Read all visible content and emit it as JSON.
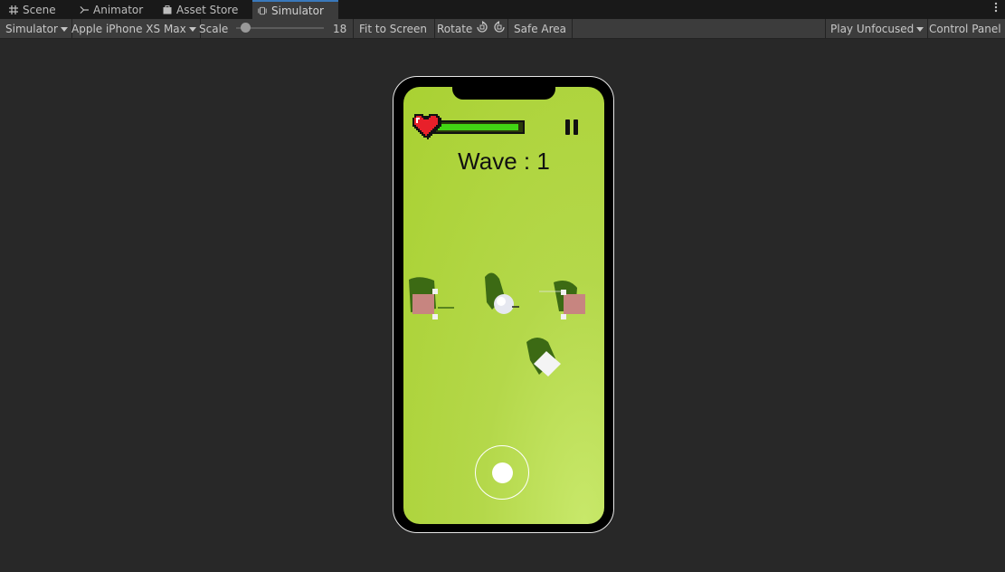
{
  "tabs": [
    {
      "label": "Scene",
      "icon": "grid-icon"
    },
    {
      "label": "Animator",
      "icon": "animator-icon"
    },
    {
      "label": "Asset Store",
      "icon": "bag-icon"
    },
    {
      "label": "Simulator",
      "icon": "simulator-icon",
      "active": true
    }
  ],
  "toolbar": {
    "mode": "Simulator",
    "device": "Apple iPhone XS Max",
    "scale_label": "Scale",
    "scale_value": "18",
    "fit": "Fit to Screen",
    "rotate": "Rotate",
    "safe_area": "Safe Area",
    "play_mode": "Play Unfocused",
    "control_panel": "Control Panel"
  },
  "game": {
    "wave_text": "Wave : 1",
    "health_fraction": 0.97,
    "colors": {
      "ground": "#a9d132",
      "health": "#41d514",
      "heart": "#e8202a"
    }
  }
}
